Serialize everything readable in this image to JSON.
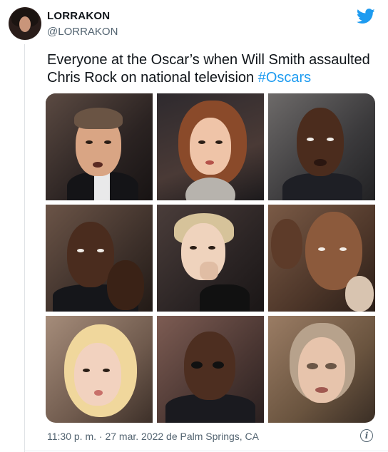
{
  "tweet": {
    "display_name": "LORRAKON",
    "handle": "@LORRAKON",
    "text_before_hashtag": "Everyone at the Oscar’s when Will Smith assaulted Chris Rock on national television ",
    "hashtag": "#Oscars",
    "timestamp": "11:30 p. m. · 27 mar. 2022 de Palm Springs, CA",
    "info_glyph": "i"
  },
  "icons": {
    "brand": "twitter-bird-icon",
    "info": "info-icon"
  },
  "colors": {
    "accent": "#1d9bf0",
    "text": "#0f1419",
    "secondary": "#536471"
  },
  "media": {
    "layout": "3x3 grid of reaction photos"
  }
}
